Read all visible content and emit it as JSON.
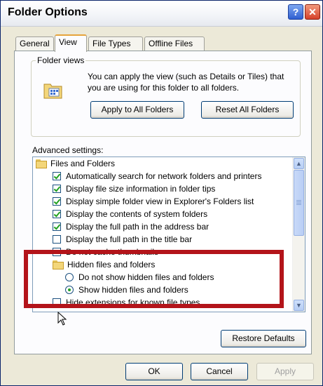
{
  "window": {
    "title": "Folder Options",
    "help_label": "?",
    "close_label": "✕"
  },
  "tabs": [
    {
      "label": "General"
    },
    {
      "label": "View"
    },
    {
      "label": "File Types"
    },
    {
      "label": "Offline Files"
    }
  ],
  "folder_views": {
    "title": "Folder views",
    "description": "You can apply the view (such as Details or Tiles) that you are using for this folder to all folders.",
    "apply_label": "Apply to All Folders",
    "reset_label": "Reset All Folders"
  },
  "advanced": {
    "label": "Advanced settings:",
    "items": [
      {
        "type": "folder",
        "label": "Files and Folders"
      },
      {
        "type": "checkbox",
        "checked": true,
        "label": "Automatically search for network folders and printers"
      },
      {
        "type": "checkbox",
        "checked": true,
        "label": "Display file size information in folder tips"
      },
      {
        "type": "checkbox",
        "checked": true,
        "label": "Display simple folder view in Explorer's Folders list"
      },
      {
        "type": "checkbox",
        "checked": true,
        "label": "Display the contents of system folders"
      },
      {
        "type": "checkbox",
        "checked": true,
        "label": "Display the full path in the address bar"
      },
      {
        "type": "checkbox",
        "checked": false,
        "label": "Display the full path in the title bar"
      },
      {
        "type": "checkbox",
        "checked": false,
        "label": "Do not cache thumbnails"
      },
      {
        "type": "folder",
        "label": "Hidden files and folders"
      },
      {
        "type": "radio",
        "checked": false,
        "label": "Do not show hidden files and folders"
      },
      {
        "type": "radio",
        "checked": true,
        "label": "Show hidden files and folders"
      },
      {
        "type": "checkbox",
        "checked": false,
        "label": "Hide extensions for known file types"
      }
    ]
  },
  "buttons": {
    "restore_label": "Restore Defaults",
    "ok_label": "OK",
    "cancel_label": "Cancel",
    "apply_label": "Apply"
  },
  "colors": {
    "highlight": "#b3141a",
    "check": "#21a121",
    "button_border": "#003c74"
  }
}
